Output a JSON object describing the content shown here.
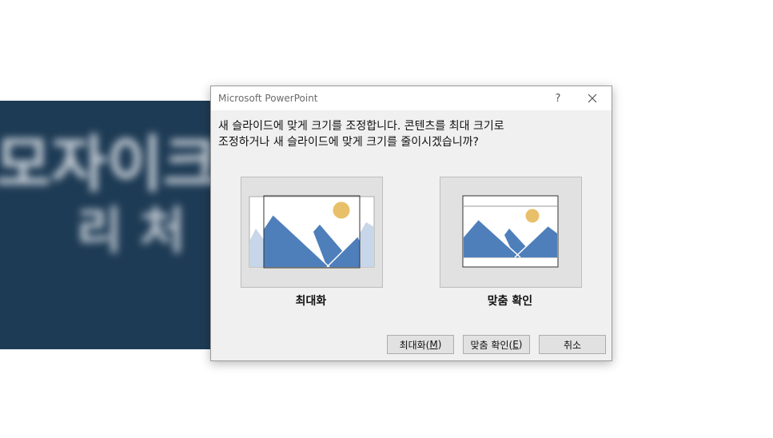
{
  "background": {
    "line1": "모자이크",
    "line2": "리 처"
  },
  "dialog": {
    "title": "Microsoft PowerPoint",
    "help_label": "?",
    "message_line1": "새 슬라이드에 맞게 크기를 조정합니다. 콘텐츠를 최대 크기로",
    "message_line2": "조정하거나 새 슬라이드에 맞게 크기를 줄이시겠습니까?",
    "options": {
      "maximize_label": "최대화",
      "fit_label": "맞춤 확인"
    },
    "buttons": {
      "maximize_text": "최대화(",
      "maximize_key": "M",
      "maximize_end": ")",
      "fit_text": "맞춤 확인(",
      "fit_key": "E",
      "fit_end": ")",
      "cancel": "취소"
    }
  },
  "colors": {
    "slide_bg": "#1e3b55",
    "mountain": "#4e7fbb",
    "mountain_light": "#c7d6e8",
    "sun": "#e8c06a"
  }
}
